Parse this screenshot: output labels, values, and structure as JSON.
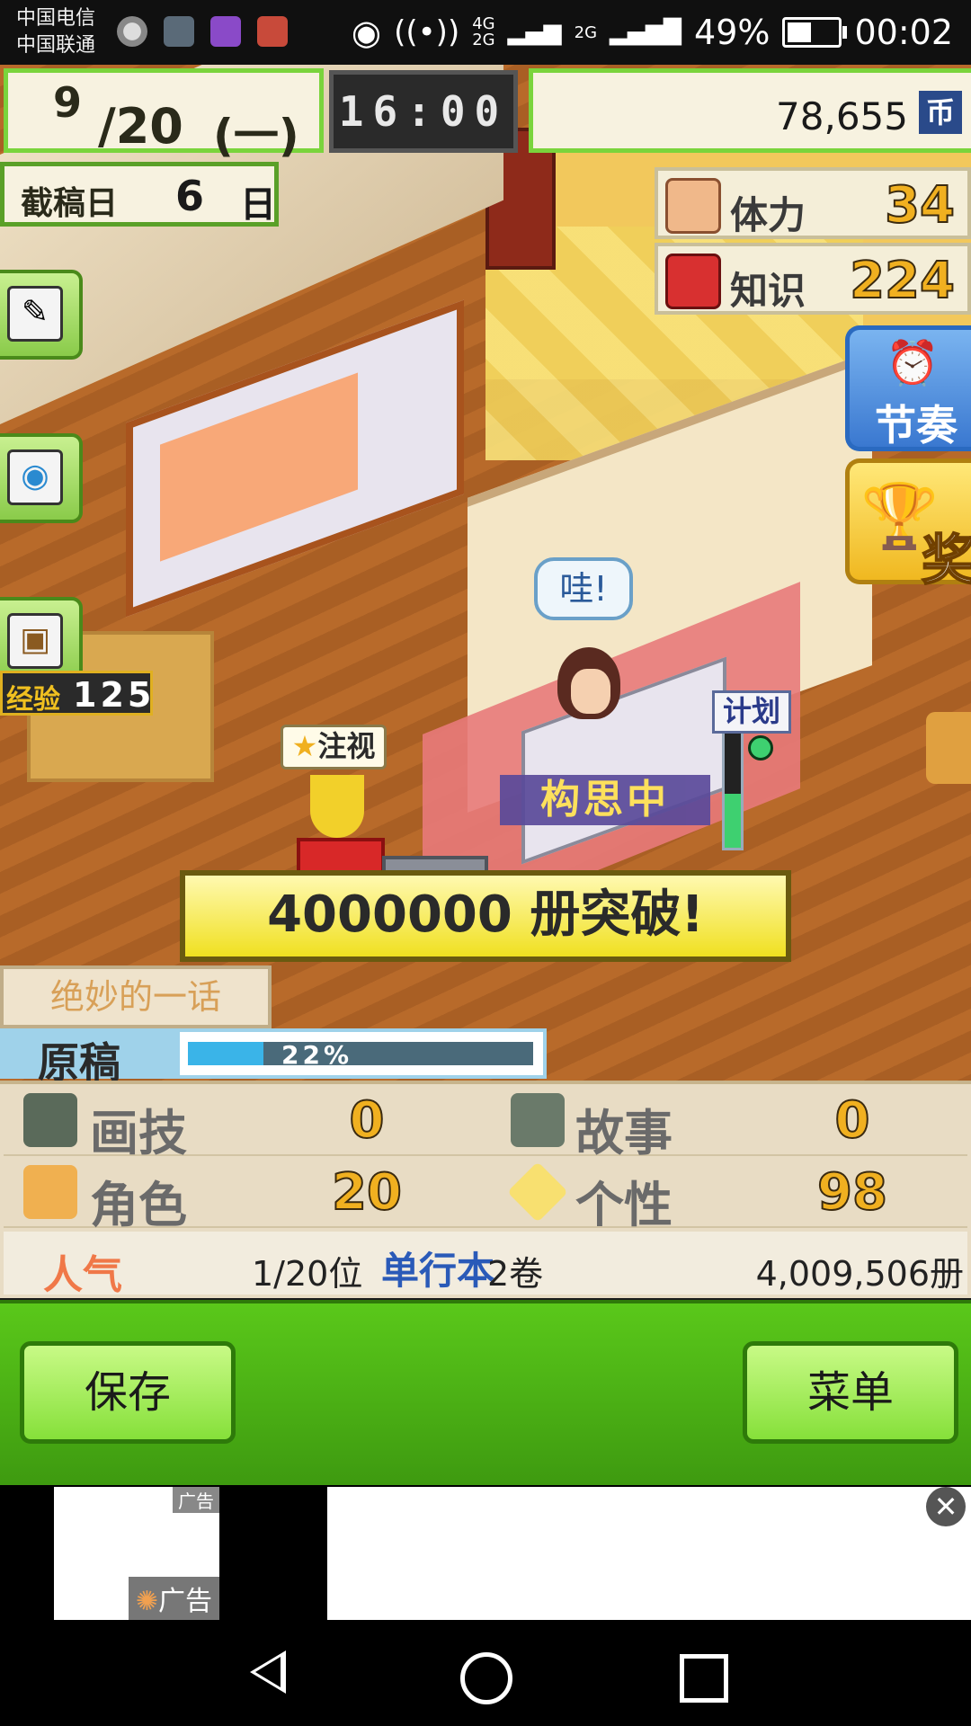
{
  "status_bar": {
    "carrier_1": "中国电信",
    "carrier_2": "中国联通",
    "network_1": "4G",
    "network_2": "2G",
    "network_3": "2G",
    "battery": "49%",
    "time": "00:02",
    "battery_level": 0.49
  },
  "hud": {
    "month": "9",
    "week": "/20",
    "weekday": "(一)",
    "clock": "16:00",
    "money": "78,655",
    "currency_icon": "币",
    "deadline_label": "截稿日",
    "deadline_value": "6",
    "deadline_unit": "日",
    "stamina_label": "体力",
    "stamina_value": "34",
    "knowledge_label": "知识",
    "knowledge_value": "224"
  },
  "side_buttons": {
    "rhythm_label": "节奏",
    "award_label": "奖"
  },
  "left_buttons": {
    "edit_icon": "✎",
    "camera_icon": "◉",
    "bag_icon": "▣",
    "exp_label": "经验",
    "exp_value": "125"
  },
  "scene": {
    "speech": "哇!",
    "attention_tag": "注视",
    "plan_tag": "计划",
    "status_tag": "构思中",
    "banner": "4000000 册突破!",
    "chapter_title": "绝妙的一话",
    "manuscript_label": "原稿",
    "manuscript_percent": "22%",
    "manuscript_progress": 0.22
  },
  "stats": {
    "drawing_label": "画技",
    "drawing_value": "0",
    "story_label": "故事",
    "story_value": "0",
    "character_label": "角色",
    "character_value": "20",
    "personality_label": "个性",
    "personality_value": "98",
    "popularity_label": "人气",
    "rank": "1/20位",
    "tankobon_label": "单行本",
    "tankobon_value": "2卷",
    "copies": "4,009,506册"
  },
  "bottom": {
    "save_label": "保存",
    "menu_label": "菜单"
  },
  "ads": {
    "tag_small": "广告",
    "tag_large": "广告",
    "close": "✕"
  }
}
